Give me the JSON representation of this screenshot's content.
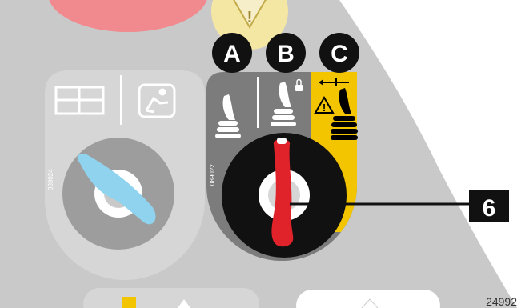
{
  "figure": {
    "figure_id": "24992"
  },
  "left_switch": {
    "sticker_code": "089024",
    "icons": [
      "dual-window-icon",
      "seated-operator-icon"
    ]
  },
  "right_switch": {
    "sticker_code": "089022",
    "positions": [
      {
        "letter": "A",
        "icon": "joystick-icon"
      },
      {
        "letter": "B",
        "icon": "joystick-locked-icon"
      },
      {
        "letter": "C",
        "icon": "joystick-warning-icon"
      }
    ],
    "active_position_color": "#f3c400"
  },
  "callout": {
    "label": "6"
  },
  "top_icons": [
    "emergency-stop-icon",
    "warning-icon"
  ],
  "colors": {
    "panel": "#c9c9c9",
    "sticker_gray": "#7c7c7c",
    "knob_red": "#e0232a",
    "knob_blue": "#8fd3ee",
    "warning_yellow": "#f3c400"
  }
}
